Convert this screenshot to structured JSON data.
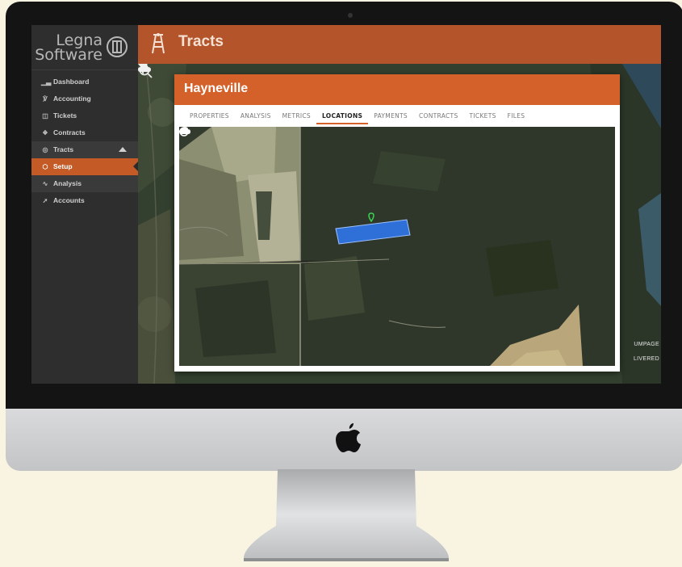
{
  "app": {
    "brand_line1": "Legna",
    "brand_line2": "Software",
    "page_title": "Tracts"
  },
  "sidebar": {
    "items": [
      {
        "label": "Dashboard",
        "icon": "bar-chart-icon"
      },
      {
        "label": "Accounting",
        "icon": "balance-icon"
      },
      {
        "label": "Tickets",
        "icon": "clipboard-icon"
      },
      {
        "label": "Contracts",
        "icon": "contract-icon"
      },
      {
        "label": "Tracts",
        "icon": "target-icon"
      },
      {
        "label": "Setup",
        "icon": "hexagon-icon"
      },
      {
        "label": "Analysis",
        "icon": "trend-icon"
      },
      {
        "label": "Accounts",
        "icon": "arrow-icon"
      }
    ]
  },
  "modal": {
    "title": "Hayneville",
    "tabs": [
      "PROPERTIES",
      "ANALYSIS",
      "METRICS",
      "LOCATIONS",
      "PAYMENTS",
      "CONTRACTS",
      "TICKETS",
      "FILES"
    ],
    "active_tab": "LOCATIONS"
  },
  "background_map": {
    "label_1": "UMPAGE",
    "label_2": "LIVERED"
  },
  "colors": {
    "accent": "#d5612a",
    "header": "#b3542a",
    "sidebar": "#2e2e2e",
    "parcel": "#2f6fd8",
    "marker": "#39d353"
  }
}
